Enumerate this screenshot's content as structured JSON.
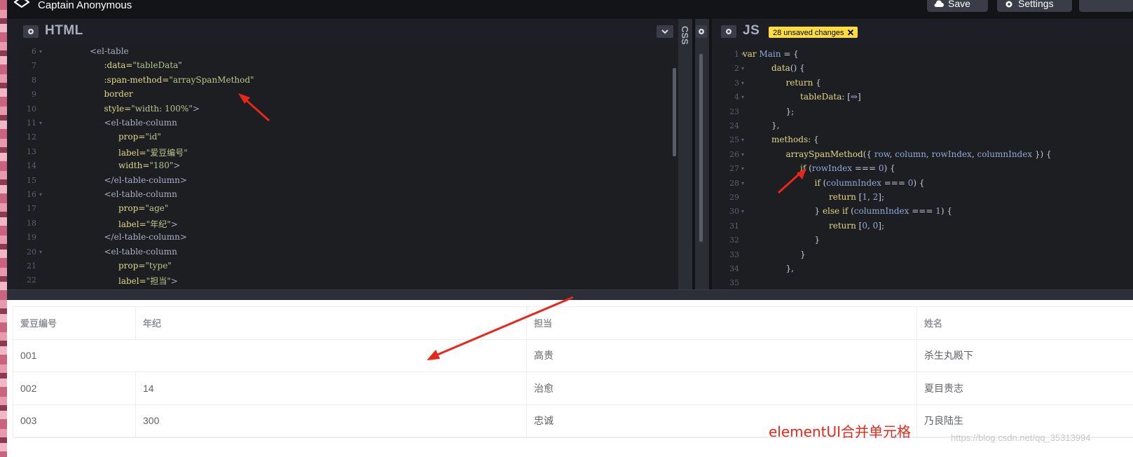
{
  "app": {
    "user_name": "Captain Anonymous"
  },
  "topbar": {
    "save_label": "Save",
    "settings_label": "Settings"
  },
  "html_pane": {
    "title": "HTML",
    "lines": [
      {
        "n": "6",
        "fold": true,
        "indent": 2,
        "tokens": [
          [
            "t-tag",
            "<el-table"
          ]
        ]
      },
      {
        "n": "7",
        "fold": false,
        "indent": 3,
        "tokens": [
          [
            "t-attr",
            ":data="
          ],
          [
            "t-str",
            "\"tableData\""
          ]
        ]
      },
      {
        "n": "8",
        "fold": false,
        "indent": 3,
        "tokens": [
          [
            "t-attr",
            ":span-method="
          ],
          [
            "t-str",
            "\"arraySpanMethod\""
          ]
        ]
      },
      {
        "n": "9",
        "fold": false,
        "indent": 3,
        "tokens": [
          [
            "t-attr",
            "border"
          ]
        ]
      },
      {
        "n": "10",
        "fold": false,
        "indent": 3,
        "tokens": [
          [
            "t-attr",
            "style="
          ],
          [
            "t-str",
            "\"width: 100%\""
          ],
          [
            "t-tag",
            ">"
          ]
        ]
      },
      {
        "n": "11",
        "fold": true,
        "indent": 3,
        "tokens": [
          [
            "t-tag",
            "<el-table-column"
          ]
        ]
      },
      {
        "n": "12",
        "fold": false,
        "indent": 4,
        "tokens": [
          [
            "t-attr",
            "prop="
          ],
          [
            "t-str",
            "\"id\""
          ]
        ]
      },
      {
        "n": "13",
        "fold": false,
        "indent": 4,
        "tokens": [
          [
            "t-attr",
            "label="
          ],
          [
            "t-str",
            "\"爱豆编号\""
          ]
        ]
      },
      {
        "n": "14",
        "fold": false,
        "indent": 4,
        "tokens": [
          [
            "t-attr",
            "width="
          ],
          [
            "t-str",
            "\"180\""
          ],
          [
            "t-tag",
            ">"
          ]
        ]
      },
      {
        "n": "15",
        "fold": false,
        "indent": 3,
        "tokens": [
          [
            "t-tag",
            "</el-table-column>"
          ]
        ]
      },
      {
        "n": "16",
        "fold": true,
        "indent": 3,
        "tokens": [
          [
            "t-tag",
            "<el-table-column"
          ]
        ]
      },
      {
        "n": "17",
        "fold": false,
        "indent": 4,
        "tokens": [
          [
            "t-attr",
            "prop="
          ],
          [
            "t-str",
            "\"age\""
          ]
        ]
      },
      {
        "n": "18",
        "fold": false,
        "indent": 4,
        "tokens": [
          [
            "t-attr",
            "label="
          ],
          [
            "t-str",
            "\"年纪\""
          ],
          [
            "t-tag",
            ">"
          ]
        ]
      },
      {
        "n": "19",
        "fold": false,
        "indent": 3,
        "tokens": [
          [
            "t-tag",
            "</el-table-column>"
          ]
        ]
      },
      {
        "n": "20",
        "fold": true,
        "indent": 3,
        "tokens": [
          [
            "t-tag",
            "<el-table-column"
          ]
        ]
      },
      {
        "n": "21",
        "fold": false,
        "indent": 4,
        "tokens": [
          [
            "t-attr",
            "prop="
          ],
          [
            "t-str",
            "\"type\""
          ]
        ]
      },
      {
        "n": "22",
        "fold": false,
        "indent": 4,
        "tokens": [
          [
            "t-attr",
            "label="
          ],
          [
            "t-str",
            "\"担当\""
          ],
          [
            "t-tag",
            ">"
          ]
        ]
      }
    ]
  },
  "css_pane": {
    "title": "CSS"
  },
  "js_pane": {
    "title": "JS",
    "badge": "28 unsaved changes",
    "lines": [
      {
        "n": "1",
        "fold": true,
        "indent": 0,
        "tokens": [
          [
            "t-kw",
            "var "
          ],
          [
            "t-var",
            "Main"
          ],
          [
            "t-punc",
            " = {"
          ]
        ]
      },
      {
        "n": "2",
        "fold": true,
        "indent": 2,
        "tokens": [
          [
            "t-attr",
            "data"
          ],
          [
            "t-punc",
            "() {"
          ]
        ]
      },
      {
        "n": "3",
        "fold": true,
        "indent": 3,
        "tokens": [
          [
            "t-kw",
            "return"
          ],
          [
            "t-punc",
            " {"
          ]
        ]
      },
      {
        "n": "4",
        "fold": true,
        "indent": 4,
        "tokens": [
          [
            "t-attr",
            "tableData"
          ],
          [
            "t-punc",
            ": ["
          ],
          [
            "t-var",
            "⇔"
          ],
          [
            "t-punc",
            "]"
          ]
        ]
      },
      {
        "n": "23",
        "fold": false,
        "indent": 3,
        "tokens": [
          [
            "t-punc",
            "};"
          ]
        ]
      },
      {
        "n": "24",
        "fold": false,
        "indent": 2,
        "tokens": [
          [
            "t-punc",
            "},"
          ]
        ]
      },
      {
        "n": "25",
        "fold": true,
        "indent": 2,
        "tokens": [
          [
            "t-attr",
            "methods"
          ],
          [
            "t-punc",
            ": {"
          ]
        ]
      },
      {
        "n": "26",
        "fold": true,
        "indent": 3,
        "tokens": [
          [
            "t-attr",
            "arraySpanMethod"
          ],
          [
            "t-punc",
            "({ "
          ],
          [
            "t-var",
            "row"
          ],
          [
            "t-punc",
            ", "
          ],
          [
            "t-var",
            "column"
          ],
          [
            "t-punc",
            ", "
          ],
          [
            "t-var",
            "rowIndex"
          ],
          [
            "t-punc",
            ", "
          ],
          [
            "t-var",
            "columnIndex"
          ],
          [
            "t-punc",
            " }) {"
          ]
        ]
      },
      {
        "n": "27",
        "fold": true,
        "indent": 4,
        "tokens": [
          [
            "t-kw",
            "if"
          ],
          [
            "t-punc",
            " ("
          ],
          [
            "t-var",
            "rowIndex"
          ],
          [
            "t-punc",
            " === "
          ],
          [
            "t-var",
            "0"
          ],
          [
            "t-punc",
            ") {"
          ]
        ]
      },
      {
        "n": "28",
        "fold": true,
        "indent": 5,
        "tokens": [
          [
            "t-kw",
            "if"
          ],
          [
            "t-punc",
            " ("
          ],
          [
            "t-var",
            "columnIndex"
          ],
          [
            "t-punc",
            " === "
          ],
          [
            "t-var",
            "0"
          ],
          [
            "t-punc",
            ") {"
          ]
        ]
      },
      {
        "n": "29",
        "fold": false,
        "indent": 6,
        "tokens": [
          [
            "t-kw",
            "return"
          ],
          [
            "t-punc",
            " ["
          ],
          [
            "t-var",
            "1"
          ],
          [
            "t-punc",
            ", "
          ],
          [
            "t-var",
            "2"
          ],
          [
            "t-punc",
            "];"
          ]
        ]
      },
      {
        "n": "30",
        "fold": true,
        "indent": 5,
        "tokens": [
          [
            "t-punc",
            "} "
          ],
          [
            "t-kw",
            "else if"
          ],
          [
            "t-punc",
            " ("
          ],
          [
            "t-var",
            "columnIndex"
          ],
          [
            "t-punc",
            " === "
          ],
          [
            "t-var",
            "1"
          ],
          [
            "t-punc",
            ") {"
          ]
        ]
      },
      {
        "n": "31",
        "fold": false,
        "indent": 6,
        "tokens": [
          [
            "t-kw",
            "return"
          ],
          [
            "t-punc",
            " ["
          ],
          [
            "t-var",
            "0"
          ],
          [
            "t-punc",
            ", "
          ],
          [
            "t-var",
            "0"
          ],
          [
            "t-punc",
            "];"
          ]
        ]
      },
      {
        "n": "32",
        "fold": false,
        "indent": 5,
        "tokens": [
          [
            "t-punc",
            "}"
          ]
        ]
      },
      {
        "n": "33",
        "fold": false,
        "indent": 4,
        "tokens": [
          [
            "t-punc",
            "}"
          ]
        ]
      },
      {
        "n": "34",
        "fold": false,
        "indent": 3,
        "tokens": [
          [
            "t-punc",
            "},"
          ]
        ]
      },
      {
        "n": "35",
        "fold": false,
        "indent": 0,
        "tokens": []
      }
    ]
  },
  "table": {
    "headers": [
      "爱豆编号",
      "年纪",
      "担当",
      "姓名"
    ],
    "rows": [
      [
        "001",
        "",
        "高贵",
        "杀生丸殿下"
      ],
      [
        "002",
        "14",
        "治愈",
        "夏目贵志"
      ],
      [
        "003",
        "300",
        "忠诚",
        "乃良陆生"
      ]
    ]
  },
  "annotation": "elementUI合并单元格",
  "watermark": "https://blog.csdn.net/qq_35313994",
  "colors": {
    "accent_red": "#e8261a",
    "badge_yellow": "#ffdd40"
  }
}
